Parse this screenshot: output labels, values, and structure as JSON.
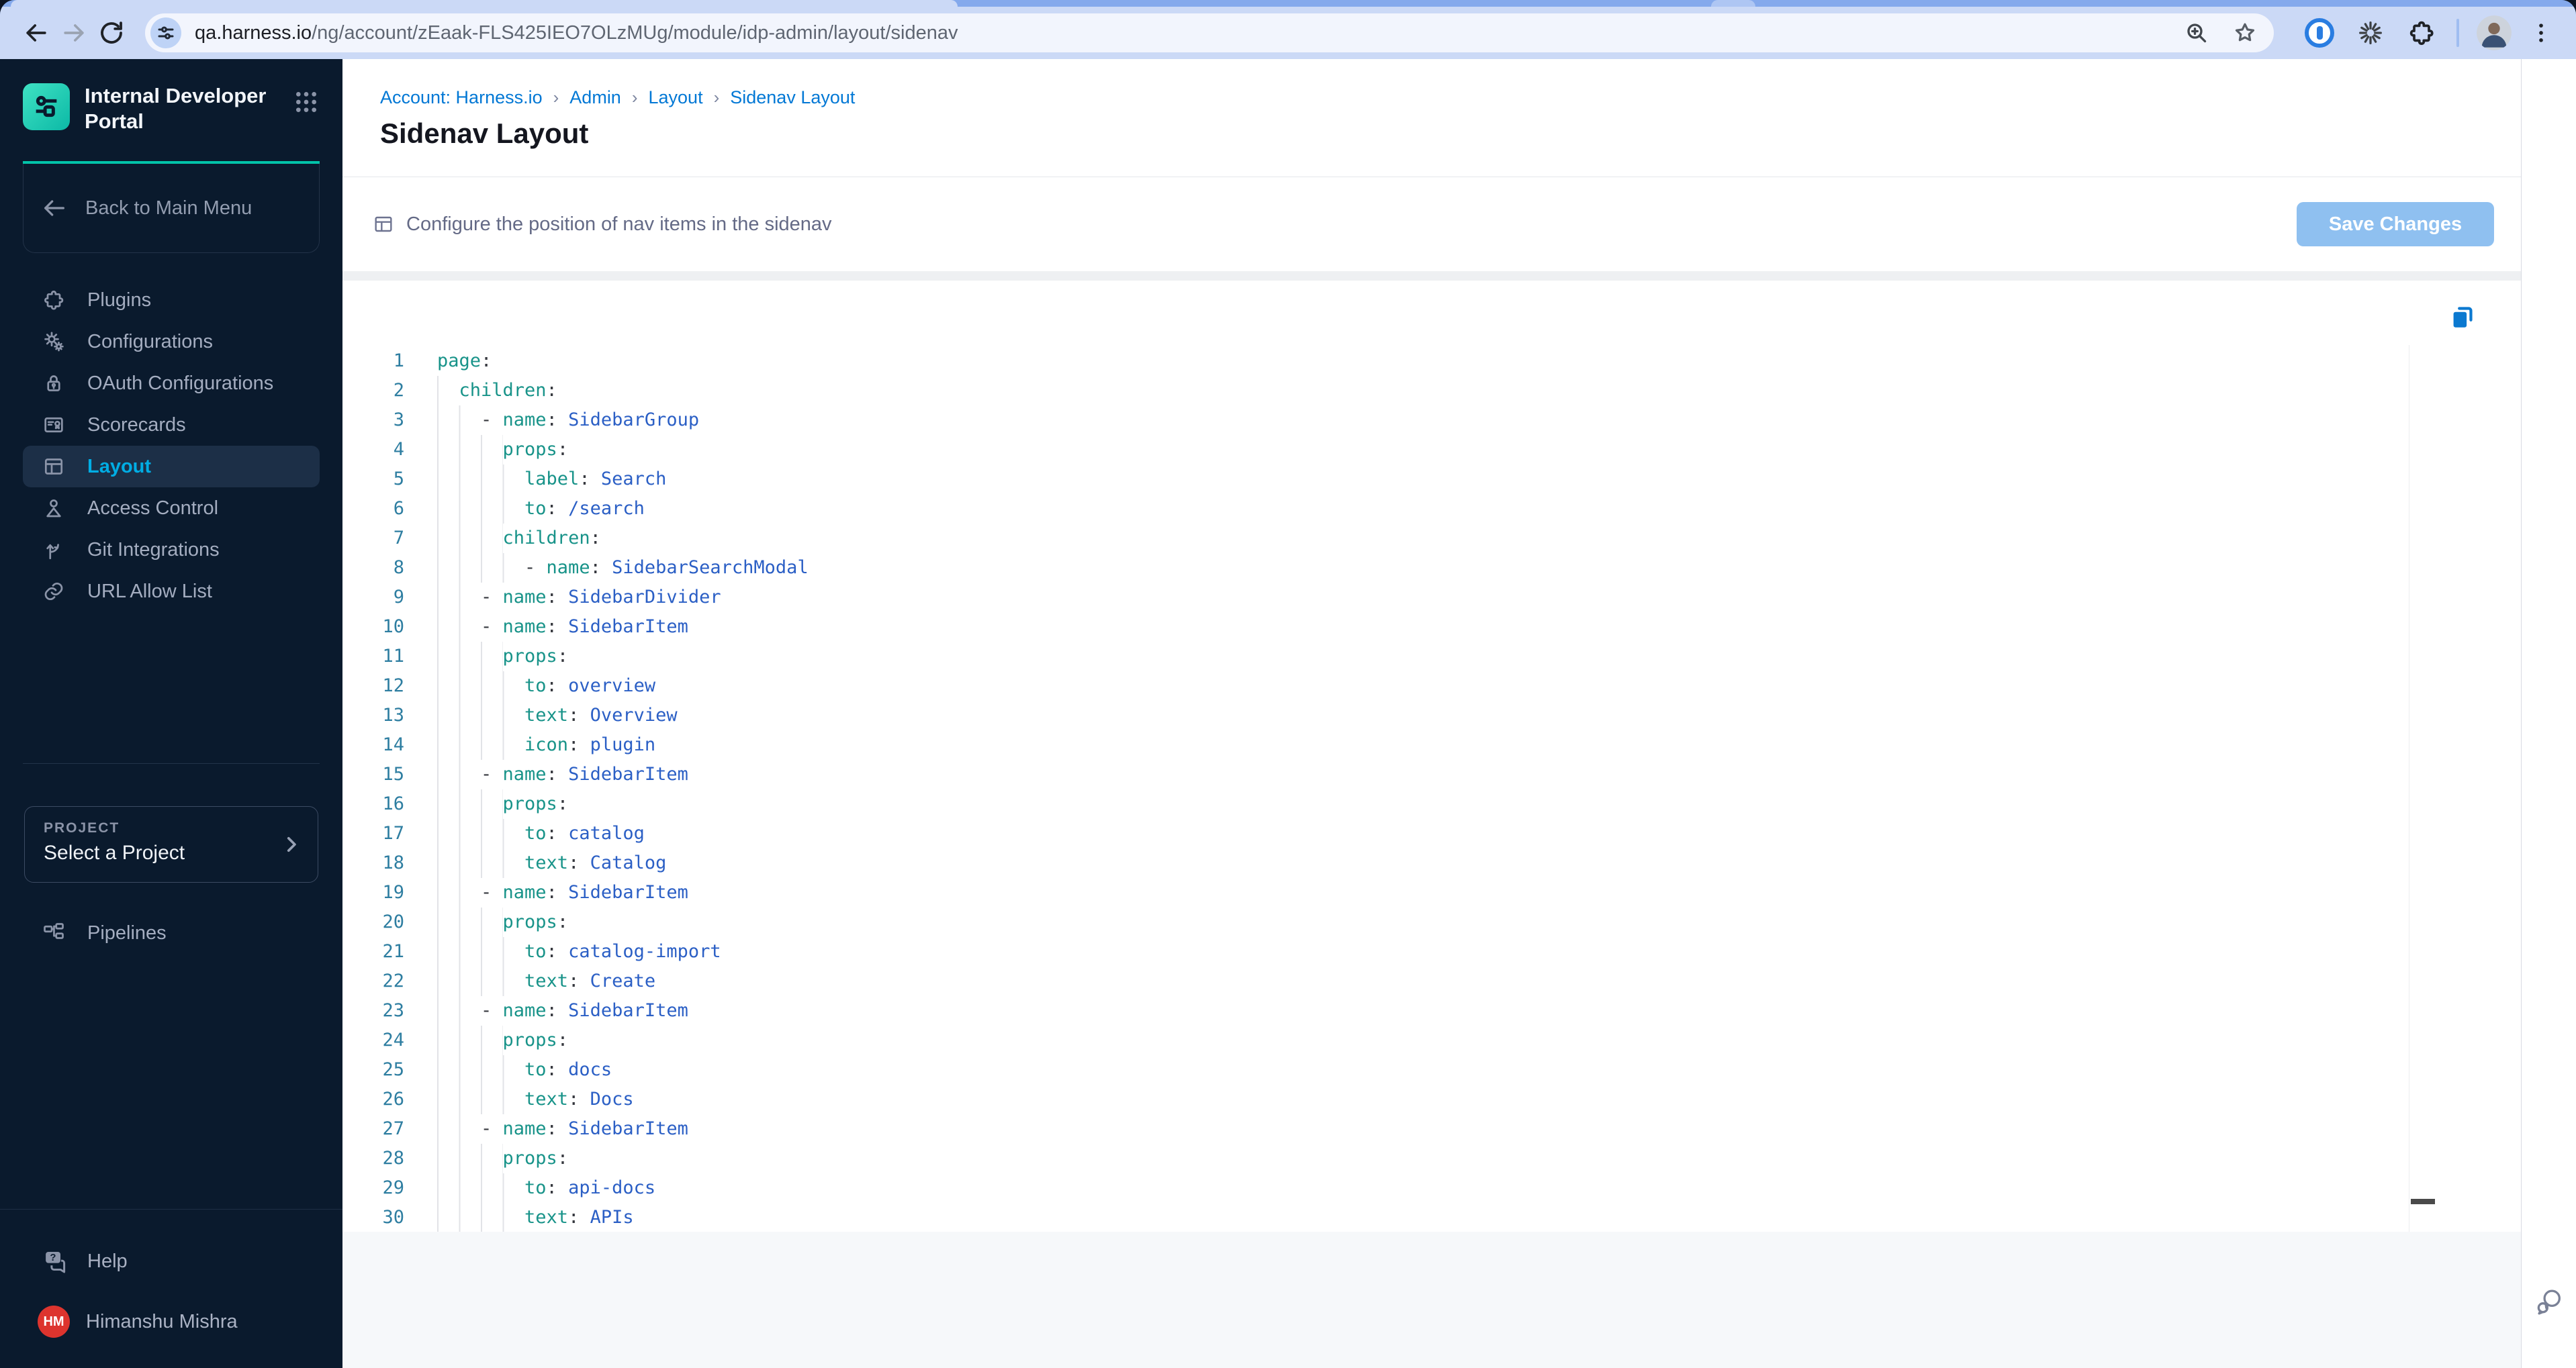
{
  "browser": {
    "url_host": "qa.harness.io",
    "url_path": "/ng/account/zEaak-FLS425IEO7OLzMUg/module/idp-admin/layout/sidenav"
  },
  "sidebar": {
    "title": "Internal Developer Portal",
    "back_label": "Back to Main Menu",
    "nav": [
      {
        "label": "Plugins",
        "icon": "puzzle",
        "selected": false
      },
      {
        "label": "Configurations",
        "icon": "gears",
        "selected": false
      },
      {
        "label": "OAuth Configurations",
        "icon": "lock",
        "selected": false
      },
      {
        "label": "Scorecards",
        "icon": "scorecard",
        "selected": false
      },
      {
        "label": "Layout",
        "icon": "layout",
        "selected": true
      },
      {
        "label": "Access Control",
        "icon": "person",
        "selected": false
      },
      {
        "label": "Git Integrations",
        "icon": "git",
        "selected": false
      },
      {
        "label": "URL Allow List",
        "icon": "link",
        "selected": false
      }
    ],
    "project": {
      "label": "PROJECT",
      "value": "Select a Project"
    },
    "pipelines_label": "Pipelines",
    "help_label": "Help",
    "user": {
      "initials": "HM",
      "name": "Himanshu Mishra"
    }
  },
  "main": {
    "breadcrumb": [
      "Account: Harness.io",
      "Admin",
      "Layout",
      "Sidenav Layout"
    ],
    "page_title": "Sidenav Layout",
    "config_text": "Configure the position of nav items in the sidenav",
    "save_label": "Save Changes"
  },
  "editor": {
    "language": "yaml",
    "lines": [
      {
        "n": 1,
        "i": 0,
        "t": [
          [
            "k",
            "page"
          ],
          [
            "p",
            ":"
          ]
        ]
      },
      {
        "n": 2,
        "i": 2,
        "t": [
          [
            "k",
            "children"
          ],
          [
            "p",
            ":"
          ]
        ]
      },
      {
        "n": 3,
        "i": 4,
        "t": [
          [
            "d",
            "- "
          ],
          [
            "k",
            "name"
          ],
          [
            "p",
            ":"
          ],
          [
            "v",
            " SidebarGroup"
          ]
        ]
      },
      {
        "n": 4,
        "i": 6,
        "t": [
          [
            "k",
            "props"
          ],
          [
            "p",
            ":"
          ]
        ]
      },
      {
        "n": 5,
        "i": 8,
        "t": [
          [
            "k",
            "label"
          ],
          [
            "p",
            ":"
          ],
          [
            "v",
            " Search"
          ]
        ]
      },
      {
        "n": 6,
        "i": 8,
        "t": [
          [
            "k",
            "to"
          ],
          [
            "p",
            ":"
          ],
          [
            "v",
            " /search"
          ]
        ]
      },
      {
        "n": 7,
        "i": 6,
        "t": [
          [
            "k",
            "children"
          ],
          [
            "p",
            ":"
          ]
        ]
      },
      {
        "n": 8,
        "i": 8,
        "t": [
          [
            "d",
            "- "
          ],
          [
            "k",
            "name"
          ],
          [
            "p",
            ":"
          ],
          [
            "v",
            " SidebarSearchModal"
          ]
        ]
      },
      {
        "n": 9,
        "i": 4,
        "t": [
          [
            "d",
            "- "
          ],
          [
            "k",
            "name"
          ],
          [
            "p",
            ":"
          ],
          [
            "v",
            " SidebarDivider"
          ]
        ]
      },
      {
        "n": 10,
        "i": 4,
        "t": [
          [
            "d",
            "- "
          ],
          [
            "k",
            "name"
          ],
          [
            "p",
            ":"
          ],
          [
            "v",
            " SidebarItem"
          ]
        ]
      },
      {
        "n": 11,
        "i": 6,
        "t": [
          [
            "k",
            "props"
          ],
          [
            "p",
            ":"
          ]
        ]
      },
      {
        "n": 12,
        "i": 8,
        "t": [
          [
            "k",
            "to"
          ],
          [
            "p",
            ":"
          ],
          [
            "v",
            " overview"
          ]
        ]
      },
      {
        "n": 13,
        "i": 8,
        "t": [
          [
            "k",
            "text"
          ],
          [
            "p",
            ":"
          ],
          [
            "v",
            " Overview"
          ]
        ]
      },
      {
        "n": 14,
        "i": 8,
        "t": [
          [
            "k",
            "icon"
          ],
          [
            "p",
            ":"
          ],
          [
            "v",
            " plugin"
          ]
        ]
      },
      {
        "n": 15,
        "i": 4,
        "t": [
          [
            "d",
            "- "
          ],
          [
            "k",
            "name"
          ],
          [
            "p",
            ":"
          ],
          [
            "v",
            " SidebarItem"
          ]
        ]
      },
      {
        "n": 16,
        "i": 6,
        "t": [
          [
            "k",
            "props"
          ],
          [
            "p",
            ":"
          ]
        ]
      },
      {
        "n": 17,
        "i": 8,
        "t": [
          [
            "k",
            "to"
          ],
          [
            "p",
            ":"
          ],
          [
            "v",
            " catalog"
          ]
        ]
      },
      {
        "n": 18,
        "i": 8,
        "t": [
          [
            "k",
            "text"
          ],
          [
            "p",
            ":"
          ],
          [
            "v",
            " Catalog"
          ]
        ]
      },
      {
        "n": 19,
        "i": 4,
        "t": [
          [
            "d",
            "- "
          ],
          [
            "k",
            "name"
          ],
          [
            "p",
            ":"
          ],
          [
            "v",
            " SidebarItem"
          ]
        ]
      },
      {
        "n": 20,
        "i": 6,
        "t": [
          [
            "k",
            "props"
          ],
          [
            "p",
            ":"
          ]
        ]
      },
      {
        "n": 21,
        "i": 8,
        "t": [
          [
            "k",
            "to"
          ],
          [
            "p",
            ":"
          ],
          [
            "v",
            " catalog-import"
          ]
        ]
      },
      {
        "n": 22,
        "i": 8,
        "t": [
          [
            "k",
            "text"
          ],
          [
            "p",
            ":"
          ],
          [
            "v",
            " Create"
          ]
        ]
      },
      {
        "n": 23,
        "i": 4,
        "t": [
          [
            "d",
            "- "
          ],
          [
            "k",
            "name"
          ],
          [
            "p",
            ":"
          ],
          [
            "v",
            " SidebarItem"
          ]
        ]
      },
      {
        "n": 24,
        "i": 6,
        "t": [
          [
            "k",
            "props"
          ],
          [
            "p",
            ":"
          ]
        ]
      },
      {
        "n": 25,
        "i": 8,
        "t": [
          [
            "k",
            "to"
          ],
          [
            "p",
            ":"
          ],
          [
            "v",
            " docs"
          ]
        ]
      },
      {
        "n": 26,
        "i": 8,
        "t": [
          [
            "k",
            "text"
          ],
          [
            "p",
            ":"
          ],
          [
            "v",
            " Docs"
          ]
        ]
      },
      {
        "n": 27,
        "i": 4,
        "t": [
          [
            "d",
            "- "
          ],
          [
            "k",
            "name"
          ],
          [
            "p",
            ":"
          ],
          [
            "v",
            " SidebarItem"
          ]
        ]
      },
      {
        "n": 28,
        "i": 6,
        "t": [
          [
            "k",
            "props"
          ],
          [
            "p",
            ":"
          ]
        ]
      },
      {
        "n": 29,
        "i": 8,
        "t": [
          [
            "k",
            "to"
          ],
          [
            "p",
            ":"
          ],
          [
            "v",
            " api-docs"
          ]
        ]
      },
      {
        "n": 30,
        "i": 8,
        "t": [
          [
            "k",
            "text"
          ],
          [
            "p",
            ":"
          ],
          [
            "v",
            " APIs"
          ]
        ]
      }
    ]
  },
  "colors": {
    "accent_teal": "#02c3a9",
    "selected_cyan": "#00ade4",
    "link_blue": "#0278d5",
    "save_button_blue": "#8fc0f0",
    "copy_icon_blue": "#0b79d0",
    "avatar_red": "#dd342e",
    "sidebar_bg": "#0a1a2d",
    "code_key_teal": "#189389",
    "code_value_blue": "#2b5fc5"
  }
}
